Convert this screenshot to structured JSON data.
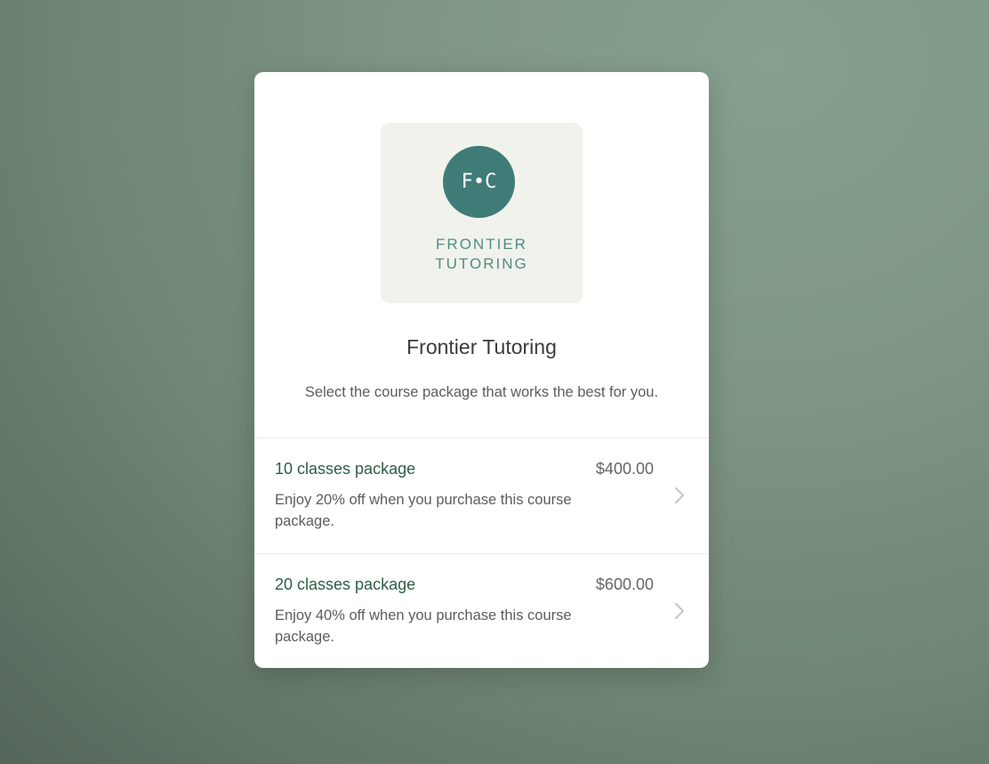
{
  "logo": {
    "monogram": "F•C",
    "line1": "FRONTIER",
    "line2": "TUTORING"
  },
  "header": {
    "title": "Frontier Tutoring",
    "subtitle": "Select the course package that works the best for you."
  },
  "packages": [
    {
      "name": "10 classes package",
      "price": "$400.00",
      "description": "Enjoy 20% off when you purchase this course package."
    },
    {
      "name": "20 classes package",
      "price": "$600.00",
      "description": "Enjoy 40% off when you purchase this course package."
    }
  ],
  "colors": {
    "brand_teal": "#3f7c77",
    "package_name": "#2e5e44"
  }
}
